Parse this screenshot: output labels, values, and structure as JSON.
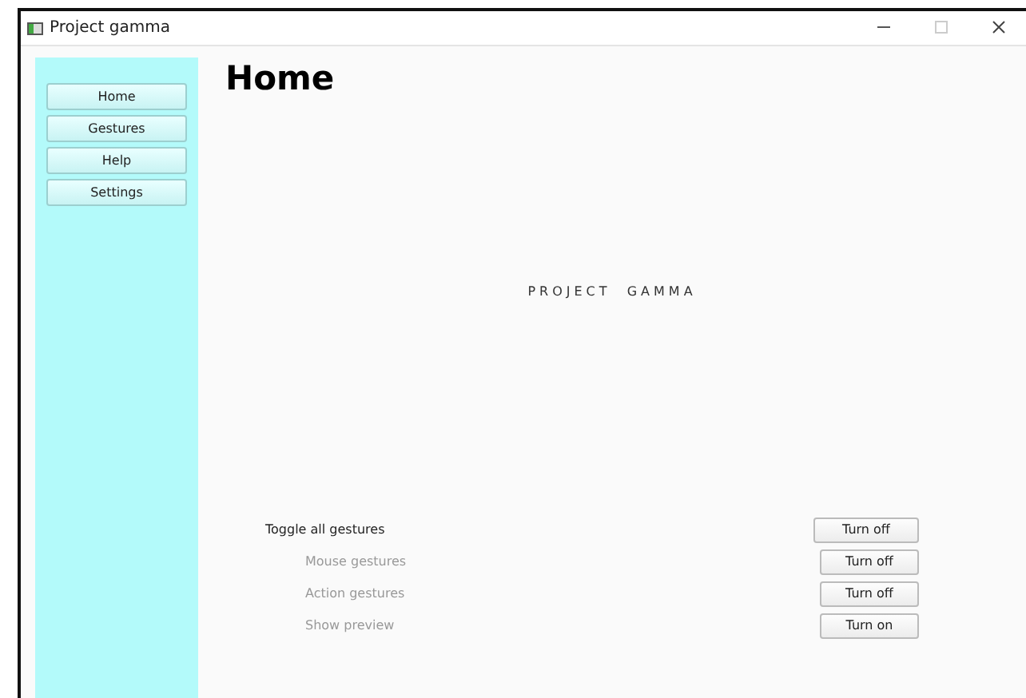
{
  "window": {
    "title": "Project gamma"
  },
  "sidebar": {
    "items": [
      {
        "label": "Home"
      },
      {
        "label": "Gestures"
      },
      {
        "label": "Help"
      },
      {
        "label": "Settings"
      }
    ]
  },
  "page": {
    "heading": "Home",
    "banner": "PROJECT  GAMMA"
  },
  "toggles": [
    {
      "kind": "master",
      "label": "Toggle all gestures",
      "button": "Turn off"
    },
    {
      "kind": "sub",
      "label": "Mouse gestures",
      "button": "Turn off"
    },
    {
      "kind": "sub",
      "label": "Action gestures",
      "button": "Turn off"
    },
    {
      "kind": "sub",
      "label": "Show preview",
      "button": "Turn on"
    }
  ]
}
